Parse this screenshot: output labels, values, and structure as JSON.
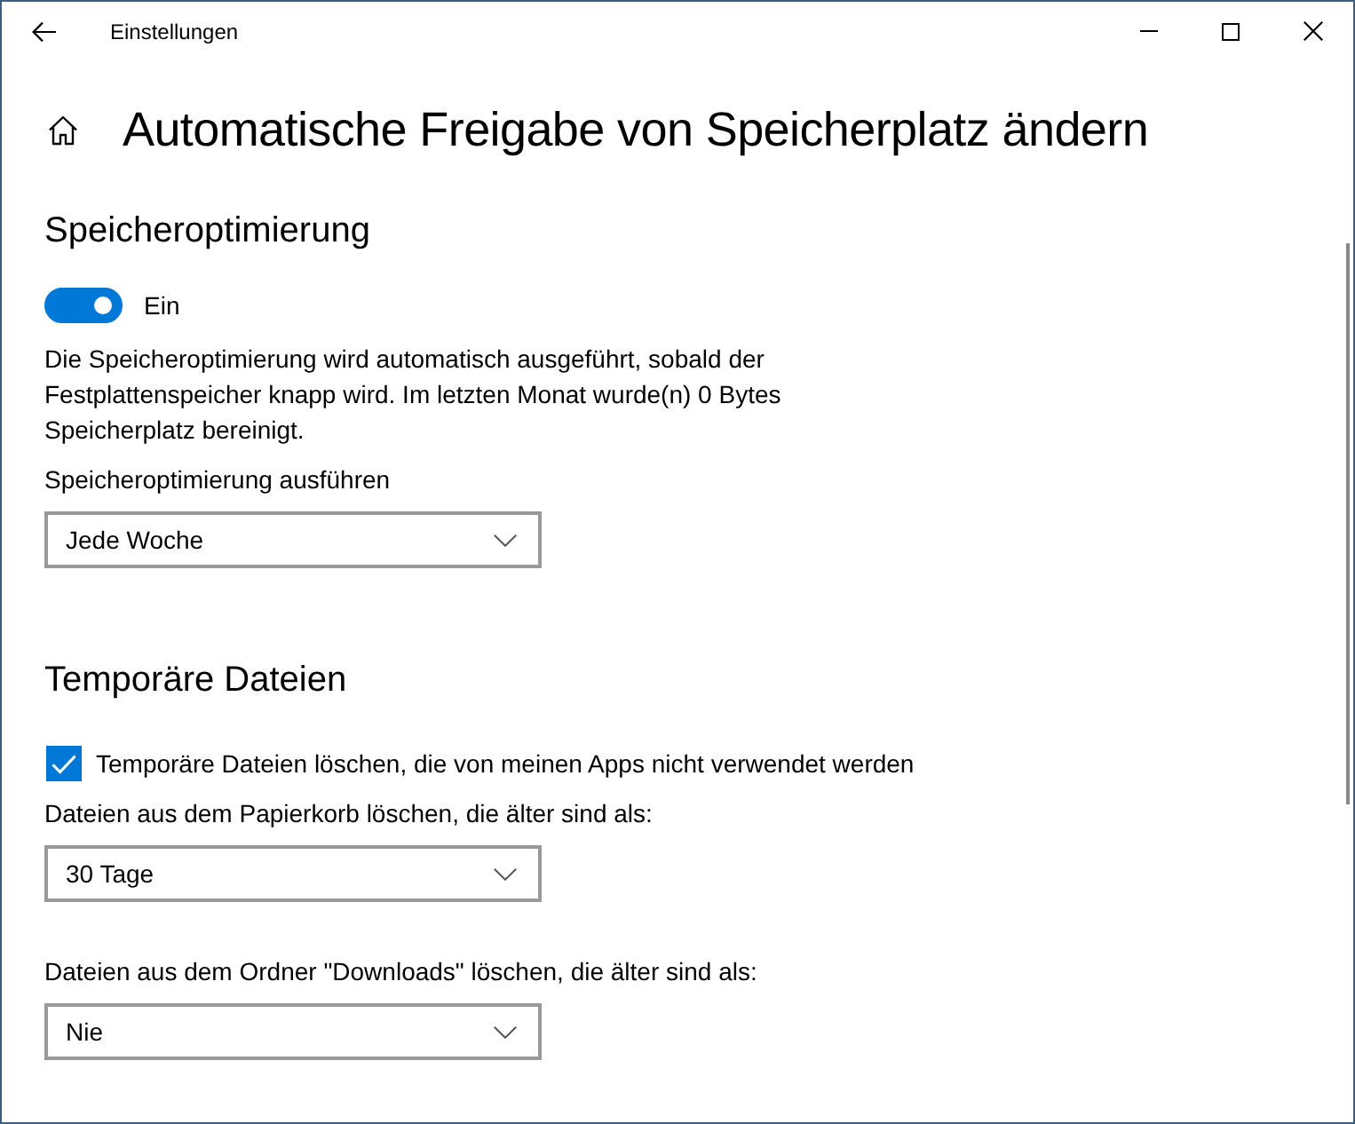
{
  "window": {
    "title": "Einstellungen"
  },
  "page": {
    "title": "Automatische Freigabe von Speicherplatz ändern"
  },
  "sections": [
    {
      "heading": "Speicheroptimierung",
      "items": [
        {
          "kind": "toggle",
          "on": true,
          "label": "Ein"
        },
        {
          "kind": "text",
          "text": "Die Speicheroptimierung wird automatisch ausgeführt, sobald der Festplattenspeicher knapp wird. Im letzten Monat wurde(n) 0 Bytes Speicherplatz bereinigt."
        },
        {
          "kind": "dropdown",
          "label": "Speicheroptimierung ausführen",
          "value": "Jede Woche"
        }
      ]
    },
    {
      "heading": "Temporäre Dateien",
      "items": [
        {
          "kind": "checkbox",
          "checked": true,
          "label": "Temporäre Dateien löschen, die von meinen Apps nicht verwendet werden"
        },
        {
          "kind": "dropdown",
          "label": "Dateien aus dem Papierkorb löschen, die älter sind als:",
          "value": "30 Tage"
        },
        {
          "kind": "dropdown",
          "label": "Dateien aus dem Ordner \"Downloads\" löschen, die älter sind als:",
          "value": "Nie"
        }
      ]
    }
  ]
}
